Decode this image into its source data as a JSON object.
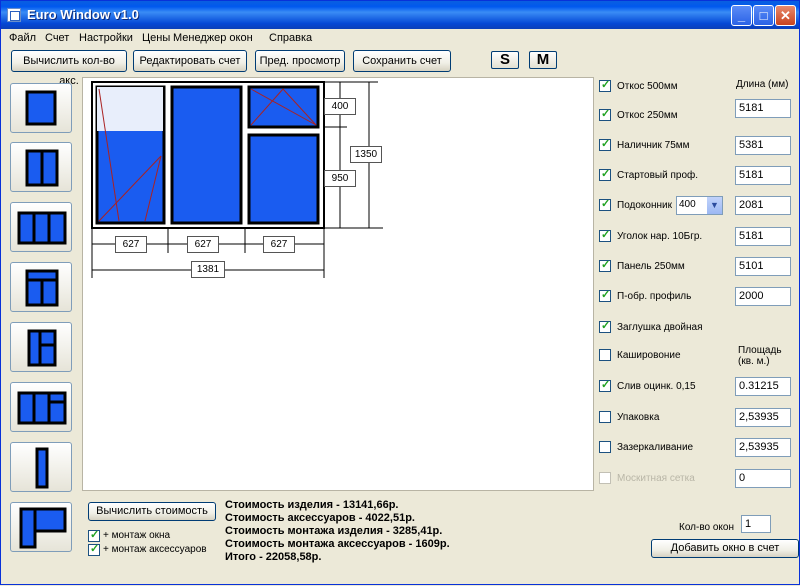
{
  "window": {
    "title": "Euro Window v1.0"
  },
  "menu": [
    "Файл",
    "Счет",
    "Настройки",
    "Цены",
    "Менеджер окон",
    "Справка"
  ],
  "toolbar": {
    "calc_acc": "Вычислить кол-во акс.",
    "edit_bill": "Редактировать счет",
    "preview": "Пред. просмотр",
    "save_bill": "Сохранить счет",
    "s_label": "S",
    "m_label": "M"
  },
  "drawing": {
    "dim_top": "400",
    "dim_bottom": "950",
    "dim_height": "1350",
    "dim_w1": "627",
    "dim_w2": "627",
    "dim_w3": "627",
    "dim_total": "1381"
  },
  "right": {
    "header_length": "Длина (мм)",
    "header_area": "Площадь (кв. м.)",
    "items": [
      {
        "label": "Откос 500мм",
        "value": "",
        "checked": true
      },
      {
        "label": "Откос 250мм",
        "value": "5181",
        "checked": true
      },
      {
        "label": "Наличник 75мм",
        "value": "5381",
        "checked": true
      },
      {
        "label": "Стартовый проф.",
        "value": "5181",
        "checked": true
      },
      {
        "label": "Подоконник",
        "value": "2081",
        "checked": true,
        "select": "400"
      },
      {
        "label": "Уголок нар. 10Бгр.",
        "value": "5181",
        "checked": true
      },
      {
        "label": "Панель 250мм",
        "value": "5101",
        "checked": true
      },
      {
        "label": "П-обр. профиль",
        "value": "2000",
        "checked": true
      },
      {
        "label": "Заглушка двойная",
        "value": "",
        "checked": true
      },
      {
        "label": "Кашировоние",
        "value": "",
        "checked": false
      },
      {
        "label": "Слив оцинк. 0,15",
        "value": "0.31215",
        "checked": true
      },
      {
        "label": "Упаковка",
        "value": "2,53935",
        "checked": false
      },
      {
        "label": "Зазеркаливание",
        "value": "2,53935",
        "checked": false
      },
      {
        "label": "Москитная сетка",
        "value": "0",
        "checked": false,
        "disabled": true
      }
    ]
  },
  "bottom": {
    "calc_button": "Вычислить стоимость",
    "check_install_window": "+ монтаж окна",
    "check_install_acc": "+ монтаж аксессуаров",
    "cost_item": "Стоимость изделия - 13141,66р.",
    "cost_acc": "Стоимость аксессуаров - 4022,51р.",
    "cost_install_item": "Стоимость монтажа изделия - 3285,41р.",
    "cost_install_acc": "Стоимость монтажа аксессуаров - 1609р.",
    "total": "Итого - 22058,58р.",
    "qty_label": "Кол-во окон",
    "qty_value": "1",
    "add_button": "Добавить окно в счет"
  }
}
